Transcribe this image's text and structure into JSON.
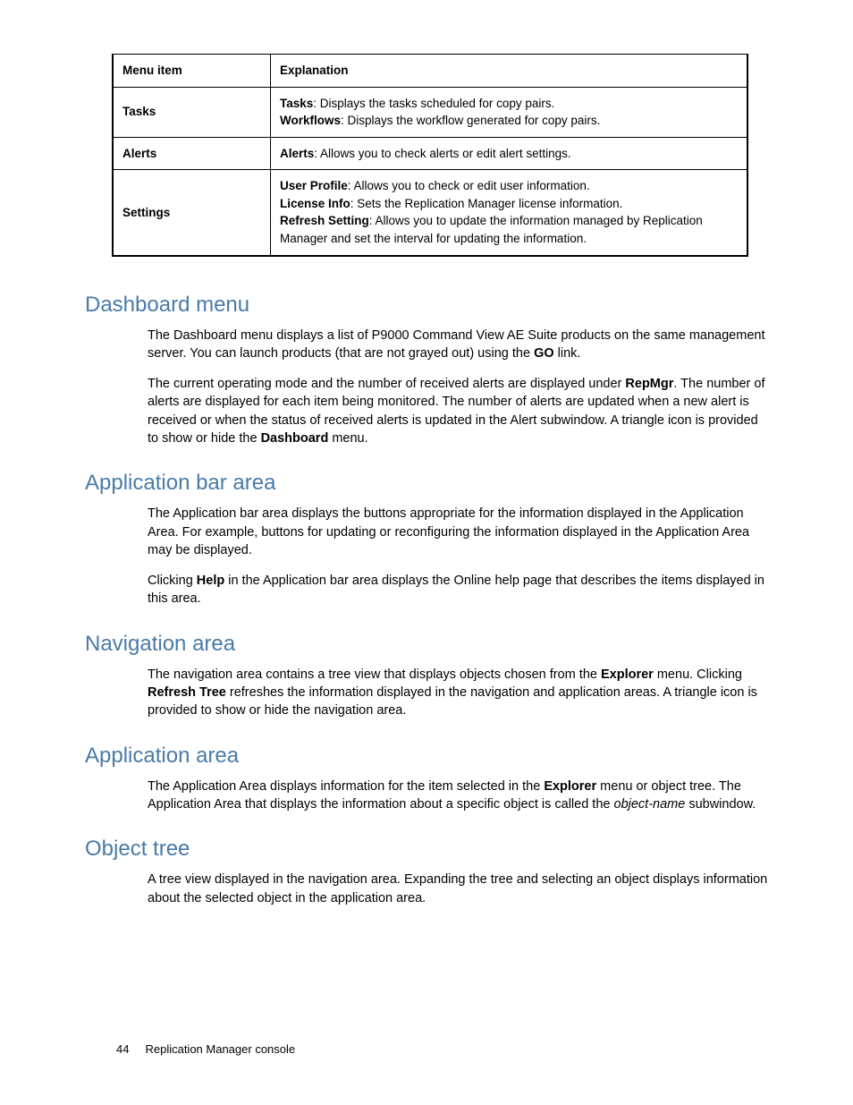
{
  "table": {
    "headers": [
      "Menu item",
      "Explanation"
    ],
    "rows": [
      {
        "item": "Tasks",
        "lines": [
          {
            "term": "Tasks",
            "text": ": Displays the tasks scheduled for copy pairs."
          },
          {
            "term": "Workflows",
            "text": ": Displays the workflow generated for copy pairs."
          }
        ]
      },
      {
        "item": "Alerts",
        "lines": [
          {
            "term": "Alerts",
            "text": ": Allows you to check alerts or edit alert settings."
          }
        ]
      },
      {
        "item": "Settings",
        "lines": [
          {
            "term": "User Profile",
            "text": ": Allows you to check or edit user information."
          },
          {
            "term": "License Info",
            "text": ": Sets the Replication Manager license information."
          },
          {
            "term": "Refresh Setting",
            "text": ": Allows you to update the information managed by Replication Manager and set the interval for updating the information."
          }
        ]
      }
    ]
  },
  "sections": {
    "dashboard": {
      "heading": "Dashboard menu",
      "p1_a": "The Dashboard menu displays a list of P9000 Command View AE Suite products on the same management server.  You can launch products (that are not grayed out) using the ",
      "p1_b": "GO",
      "p1_c": " link.",
      "p2_a": "The current operating mode and the number of received alerts are displayed under ",
      "p2_b": "RepMgr",
      "p2_c": ". The number of alerts are displayed for each item being monitored. The number of alerts are updated when a new alert is received or when the status of received alerts is updated in the Alert subwindow. A triangle icon is provided to show or hide the ",
      "p2_d": "Dashboard",
      "p2_e": " menu."
    },
    "appbar": {
      "heading": "Application bar area",
      "p1": "The Application bar area displays the buttons appropriate for the information displayed in the Application Area. For example, buttons for updating or reconfiguring the information displayed in the Application Area may be displayed.",
      "p2_a": "Clicking ",
      "p2_b": "Help",
      "p2_c": " in the Application bar area displays the Online help page that describes the items displayed in this area."
    },
    "nav": {
      "heading": "Navigation area",
      "p1_a": "The navigation area contains a tree view that displays objects chosen from the ",
      "p1_b": "Explorer",
      "p1_c": " menu. Clicking ",
      "p1_d": "Refresh Tree",
      "p1_e": " refreshes the information displayed in the navigation and application areas. A triangle icon is provided to show or hide the navigation area."
    },
    "apparea": {
      "heading": "Application area",
      "p1_a": "The Application Area displays information for the item selected in the ",
      "p1_b": "Explorer",
      "p1_c": " menu or object tree. The Application Area that displays the information about a specific object is called the ",
      "p1_d": "object-name",
      "p1_e": " subwindow."
    },
    "objtree": {
      "heading": "Object tree",
      "p1": "A tree view displayed in the navigation area.  Expanding the tree and selecting an object displays information about the selected object in the application area."
    }
  },
  "footer": {
    "page": "44",
    "title": "Replication Manager console"
  }
}
